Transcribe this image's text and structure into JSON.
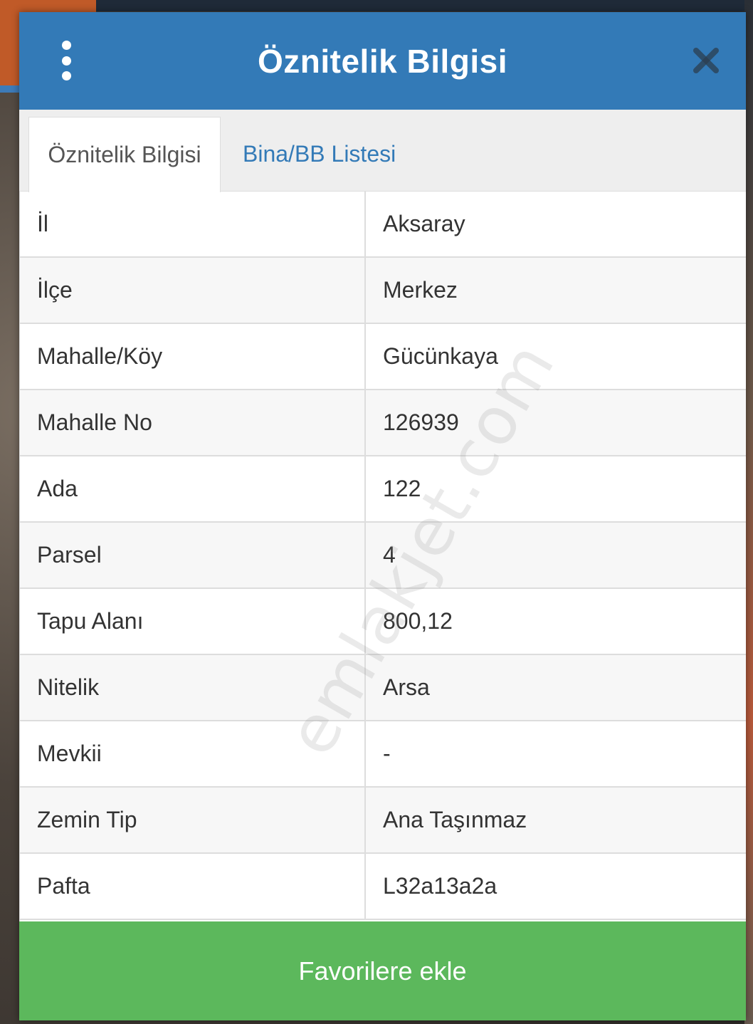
{
  "dialog": {
    "title": "Öznitelik Bilgisi"
  },
  "tabs": [
    {
      "label": "Öznitelik Bilgisi",
      "active": true
    },
    {
      "label": "Bina/BB Listesi",
      "active": false
    }
  ],
  "attributes": [
    {
      "label": "İl",
      "value": "Aksaray"
    },
    {
      "label": "İlçe",
      "value": "Merkez"
    },
    {
      "label": "Mahalle/Köy",
      "value": "Gücünkaya"
    },
    {
      "label": "Mahalle No",
      "value": "126939"
    },
    {
      "label": "Ada",
      "value": "122"
    },
    {
      "label": "Parsel",
      "value": "4"
    },
    {
      "label": "Tapu Alanı",
      "value": "800,12"
    },
    {
      "label": "Nitelik",
      "value": "Arsa"
    },
    {
      "label": "Mevkii",
      "value": "-"
    },
    {
      "label": "Zemin Tip",
      "value": "Ana Taşınmaz"
    },
    {
      "label": "Pafta",
      "value": "L32a13a2a"
    }
  ],
  "footer": {
    "favorite_label": "Favorilere ekle"
  },
  "watermark": "emlakjet.com",
  "colors": {
    "header": "#337ab7",
    "favorite_button": "#5cb85c",
    "tab_link": "#337ab7"
  },
  "icons": {
    "menu": "vertical-dots-icon",
    "close": "close-icon"
  }
}
